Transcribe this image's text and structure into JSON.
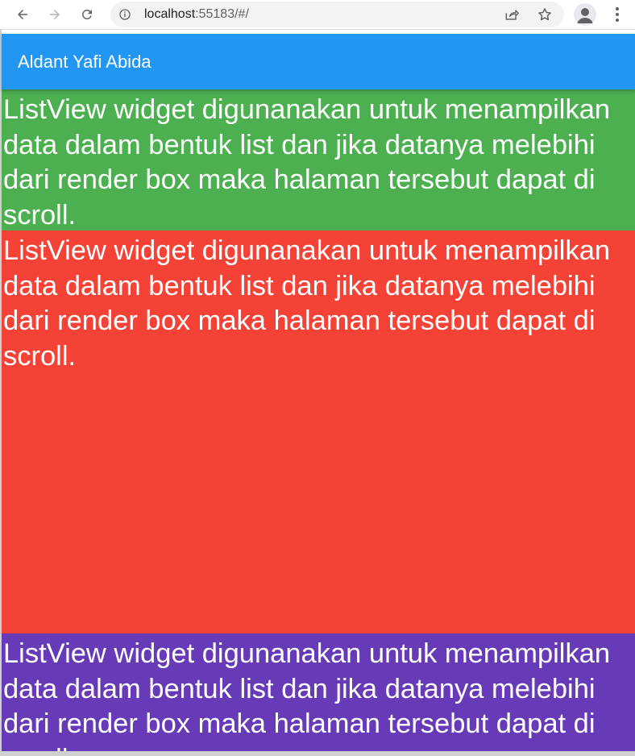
{
  "browser": {
    "url_host": "localhost",
    "url_rest": ":55183/#/"
  },
  "app": {
    "title": "Aldant Yafi Abida",
    "appbar_color": "#2196F3"
  },
  "list_items": [
    {
      "text": "ListView widget digunanakan untuk menampilkan data dalam bentuk list dan jika datanya melebihi dari render box maka halaman tersebut dapat di scroll.",
      "color": "#4CAF50"
    },
    {
      "text": "ListView widget digunanakan untuk menampilkan data dalam bentuk list dan jika datanya melebihi dari render box maka halaman tersebut dapat di scroll.",
      "color": "#F44336"
    },
    {
      "text": "ListView widget digunanakan untuk menampilkan data dalam bentuk list dan jika datanya melebihi dari render box maka halaman tersebut dapat di scroll.",
      "color": "#673AB7"
    }
  ],
  "icons": {
    "back": "back-arrow-icon",
    "forward": "forward-arrow-icon",
    "reload": "reload-icon",
    "site_info": "info-icon",
    "share": "share-icon",
    "bookmark": "star-icon",
    "profile": "profile-icon",
    "menu": "kebab-menu-icon"
  }
}
